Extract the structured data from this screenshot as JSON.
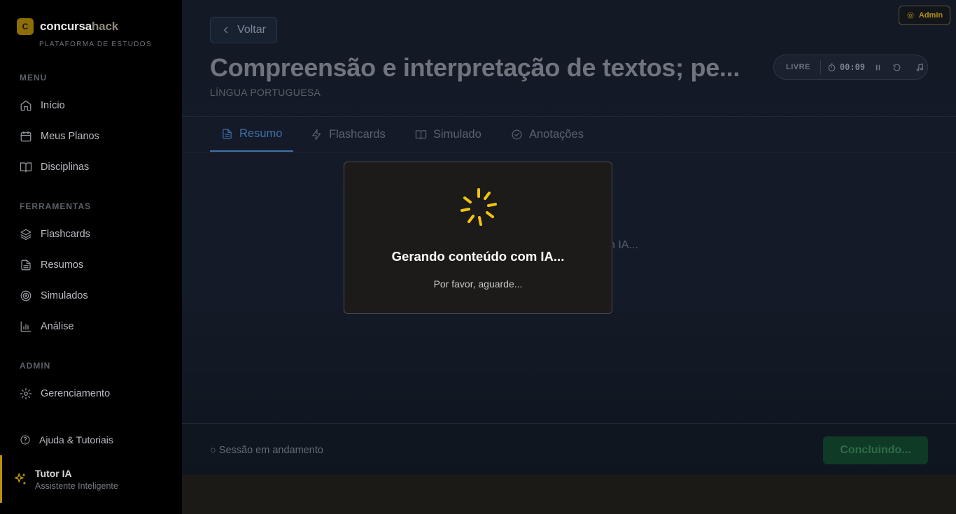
{
  "sidebar": {
    "brand_initial": "C",
    "brand_name_a": "concursa",
    "brand_name_b": "hack",
    "brand_sub": "PLATAFORMA DE ESTUDOS",
    "sections": [
      {
        "title": "MENU",
        "items": [
          {
            "label": "Início",
            "icon": "home-icon"
          },
          {
            "label": "Meus Planos",
            "icon": "calendar-icon"
          },
          {
            "label": "Disciplinas",
            "icon": "book-icon"
          }
        ]
      },
      {
        "title": "FERRAMENTAS",
        "items": [
          {
            "label": "Flashcards",
            "icon": "layers-icon"
          },
          {
            "label": "Resumos",
            "icon": "file-text-icon"
          },
          {
            "label": "Simulados",
            "icon": "target-icon"
          },
          {
            "label": "Análise",
            "icon": "bar-chart-icon"
          }
        ]
      },
      {
        "title": "ADMIN",
        "items": [
          {
            "label": "Gerenciamento",
            "icon": "gear-icon"
          }
        ]
      }
    ],
    "help_label": "Ajuda & Tutoriais",
    "tutor_title": "Tutor IA",
    "tutor_subtitle": "Assistente Inteligente"
  },
  "header": {
    "back_label": "Voltar",
    "admin_label": "Admin",
    "title": "Compreensão e interpretação de textos; pe...",
    "subject": "LÍNGUA PORTUGUESA",
    "timer_mode": "LIVRE",
    "timer_value": "00:09"
  },
  "tabs": [
    {
      "label": "Resumo",
      "icon": "file-text-icon",
      "active": true
    },
    {
      "label": "Flashcards",
      "icon": "zap-icon",
      "active": false
    },
    {
      "label": "Simulado",
      "icon": "book-open-icon",
      "active": false
    },
    {
      "label": "Anotações",
      "icon": "check-circle-icon",
      "active": false
    }
  ],
  "background_text": "n IA...",
  "footer": {
    "session_status": "○ Sessão em andamento",
    "conclude_label": "Concluindo..."
  },
  "modal": {
    "title": "Gerando conteúdo com IA...",
    "subtitle": "Por favor, aguarde..."
  },
  "colors": {
    "accent_gold": "#f2c40f",
    "active_tab": "#3f6fa8",
    "conclude_green": "#0f3a26"
  }
}
